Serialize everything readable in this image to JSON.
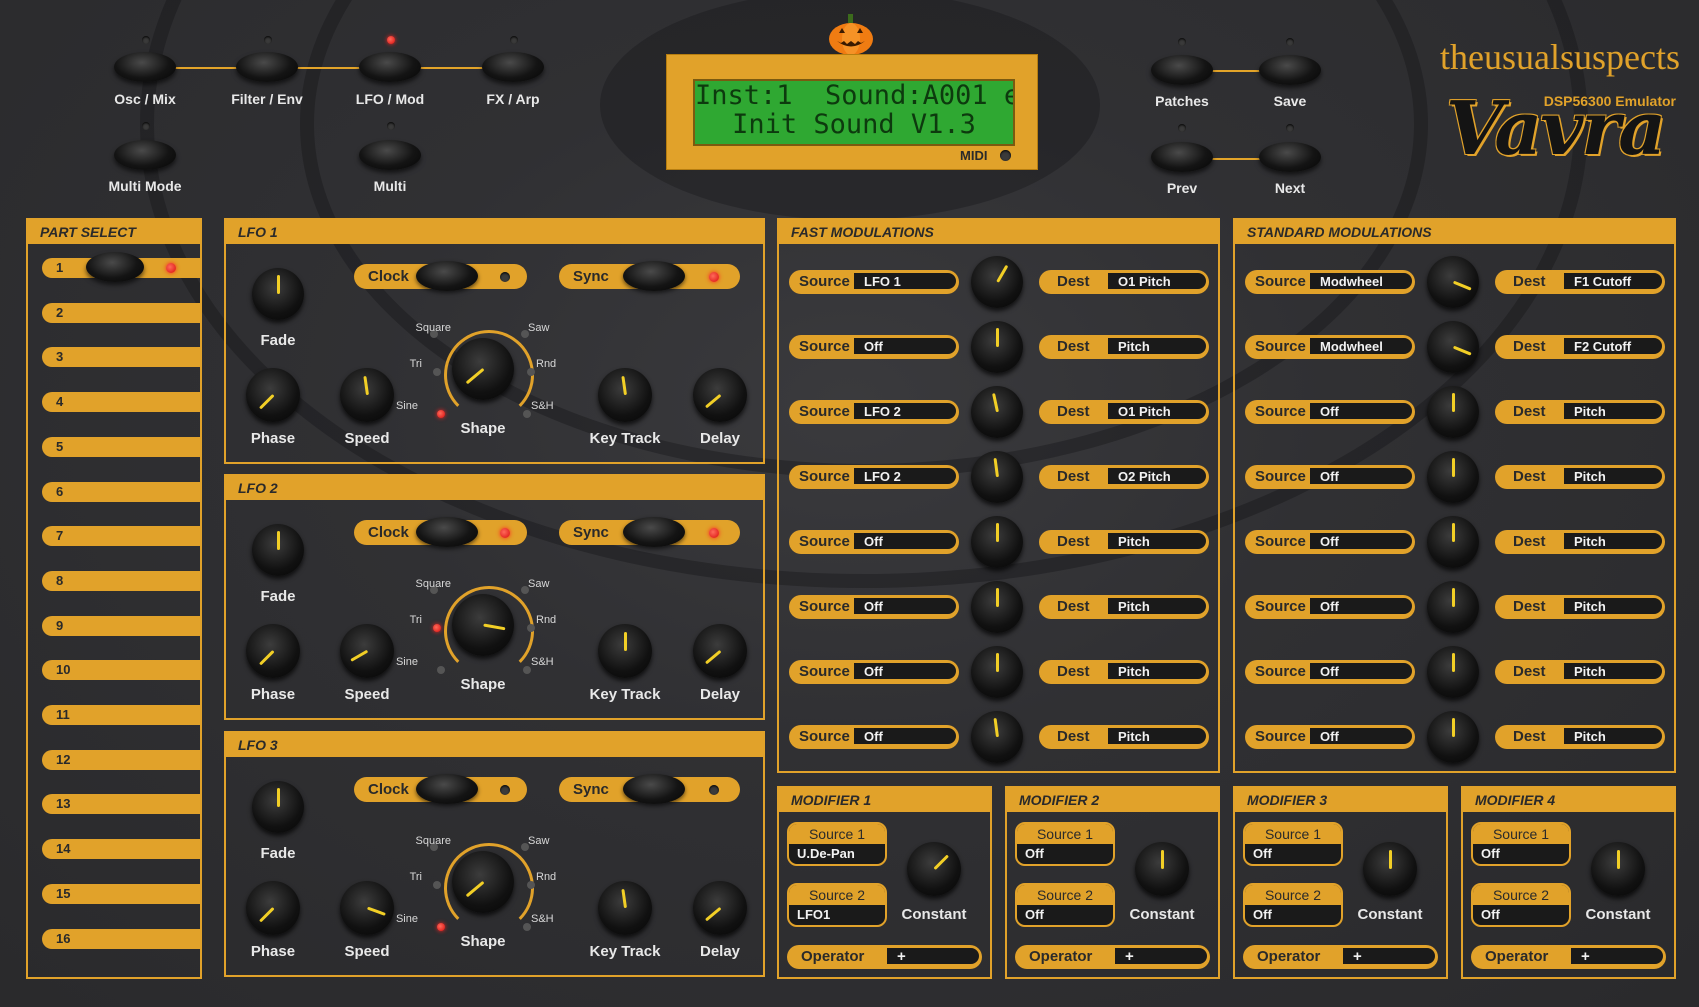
{
  "brand": {
    "company": "theusualsuspects",
    "subtitle": "DSP56300 Emulator",
    "logo": "Vavra",
    "halloween_icon": "pumpkin-icon"
  },
  "colors": {
    "accent": "#e1a22a",
    "background": "#2e2e30",
    "lcd_green": "#2fa832",
    "led_on": "#e01010",
    "knob_needle": "#f2cf26"
  },
  "nav": {
    "osc_mix": "Osc / Mix",
    "filter_env": "Filter / Env",
    "lfo_mod": "LFO / Mod",
    "fx_arp": "FX / Arp",
    "multi_mode": "Multi Mode",
    "multi": "Multi",
    "patches": "Patches",
    "save": "Save",
    "prev": "Prev",
    "next": "Next",
    "active_page": "LFO / Mod"
  },
  "lcd": {
    "line1": "Inst:1  Sound:A001 e",
    "line2": "Init Sound V1.3",
    "midi_label": "MIDI"
  },
  "part_select": {
    "title": "PART SELECT",
    "selected": "1",
    "parts": [
      "1",
      "2",
      "3",
      "4",
      "5",
      "6",
      "7",
      "8",
      "9",
      "10",
      "11",
      "12",
      "13",
      "14",
      "15",
      "16"
    ]
  },
  "lfo_labels": {
    "fade": "Fade",
    "phase": "Phase",
    "speed": "Speed",
    "shape": "Shape",
    "key_track": "Key Track",
    "delay": "Delay",
    "clock": "Clock",
    "sync": "Sync",
    "shapes": {
      "square": "Square",
      "saw": "Saw",
      "tri": "Tri",
      "rnd": "Rnd",
      "sine": "Sine",
      "sh": "S&H"
    }
  },
  "lfos": [
    {
      "title": "LFO 1",
      "clock_on": false,
      "sync_on": true,
      "shape": "Sine",
      "knobs": {
        "fade": 0,
        "phase": 225,
        "speed": -8,
        "shape": 230,
        "key_track": -8,
        "delay": 230
      }
    },
    {
      "title": "LFO 2",
      "clock_on": true,
      "sync_on": true,
      "shape": "Tri",
      "knobs": {
        "fade": 0,
        "phase": 225,
        "speed": 240,
        "shape": 100,
        "key_track": 0,
        "delay": 230
      }
    },
    {
      "title": "LFO 3",
      "clock_on": false,
      "sync_on": false,
      "shape": "Sine",
      "knobs": {
        "fade": 0,
        "phase": 225,
        "speed": 110,
        "shape": 230,
        "key_track": -8,
        "delay": 230
      }
    }
  ],
  "fast_mods": {
    "title": "FAST MODULATIONS",
    "source_label": "Source",
    "dest_label": "Dest",
    "slots": [
      {
        "source": "LFO 1",
        "dest": "O1 Pitch",
        "amount": 20
      },
      {
        "source": "Off",
        "dest": "Pitch",
        "amount": 0
      },
      {
        "source": "LFO 2",
        "dest": "O1 Pitch",
        "amount": -8
      },
      {
        "source": "LFO 2",
        "dest": "O2 Pitch",
        "amount": -5
      },
      {
        "source": "Off",
        "dest": "Pitch",
        "amount": 0
      },
      {
        "source": "Off",
        "dest": "Pitch",
        "amount": 0
      },
      {
        "source": "Off",
        "dest": "Pitch",
        "amount": 0
      },
      {
        "source": "Off",
        "dest": "Pitch",
        "amount": -5
      }
    ]
  },
  "std_mods": {
    "title": "STANDARD  MODULATIONS",
    "source_label": "Source",
    "dest_label": "Dest",
    "slots": [
      {
        "source": "Modwheel",
        "dest": "F1 Cutoff",
        "amount": 75
      },
      {
        "source": "Modwheel",
        "dest": "F2 Cutoff",
        "amount": 75
      },
      {
        "source": "Off",
        "dest": "Pitch",
        "amount": 0
      },
      {
        "source": "Off",
        "dest": "Pitch",
        "amount": 0
      },
      {
        "source": "Off",
        "dest": "Pitch",
        "amount": 0
      },
      {
        "source": "Off",
        "dest": "Pitch",
        "amount": 0
      },
      {
        "source": "Off",
        "dest": "Pitch",
        "amount": 0
      },
      {
        "source": "Off",
        "dest": "Pitch",
        "amount": 0
      }
    ]
  },
  "modifiers": [
    {
      "title": "MODIFIER 1",
      "source1_label": "Source 1",
      "source1": "U.De-Pan",
      "source2_label": "Source 2",
      "source2": "LFO1",
      "constant_label": "Constant",
      "operator_label": "Operator",
      "operator": "+",
      "constant": 45
    },
    {
      "title": "MODIFIER 2",
      "source1_label": "Source 1",
      "source1": "Off",
      "source2_label": "Source 2",
      "source2": "Off",
      "constant_label": "Constant",
      "operator_label": "Operator",
      "operator": "+",
      "constant": 0
    },
    {
      "title": "MODIFIER 3",
      "source1_label": "Source 1",
      "source1": "Off",
      "source2_label": "Source 2",
      "source2": "Off",
      "constant_label": "Constant",
      "operator_label": "Operator",
      "operator": "+",
      "constant": 0
    },
    {
      "title": "MODIFIER 4",
      "source1_label": "Source 1",
      "source1": "Off",
      "source2_label": "Source 2",
      "source2": "Off",
      "constant_label": "Constant",
      "operator_label": "Operator",
      "operator": "+",
      "constant": 0
    }
  ]
}
